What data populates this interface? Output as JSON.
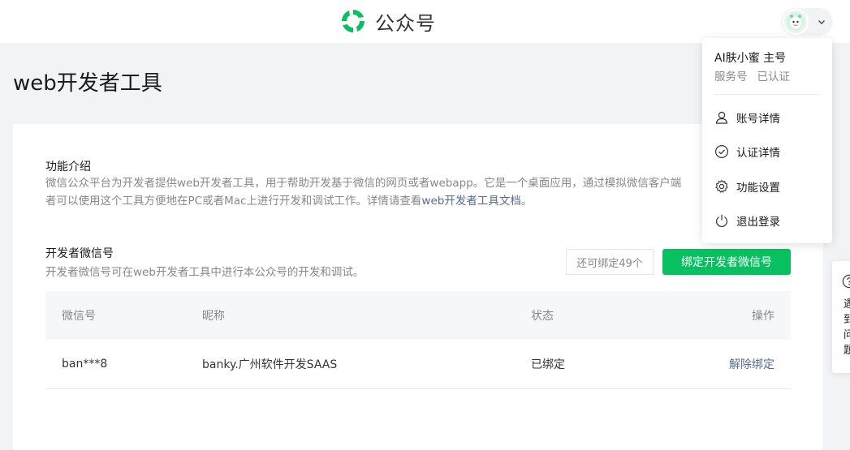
{
  "header": {
    "brand": "公众号",
    "brand_color": "#07c160",
    "account_menu_icon": "chevron-down-icon"
  },
  "page": {
    "title": "web开发者工具"
  },
  "intro": {
    "title": "功能介绍",
    "desc_line1": "微信公众平台为开发者提供web开发者工具，用于帮助开发基于微信的网页或者webapp。它是一个桌面应用，通过模拟微信客户端",
    "desc_line2_a": "者可以使用这个工具方便地在PC或者Mac上进行开发和调试工作。详情请查看",
    "desc_link": "web开发者工具文档",
    "desc_line2_b": "。"
  },
  "developer": {
    "title": "开发者微信号",
    "desc": "开发者微信号可在web开发者工具中进行本公众号的开发和调试。",
    "remaining": "还可绑定49个",
    "bind_button": "绑定开发者微信号"
  },
  "table": {
    "columns": [
      "微信号",
      "昵称",
      "状态",
      "操作"
    ],
    "rows": [
      {
        "wechat_id": "ban***8",
        "nickname": "banky.广州软件开发SAAS",
        "status": "已绑定",
        "action": "解除绑定"
      }
    ]
  },
  "account_menu": {
    "name": "AI肤小蜜 主号",
    "type": "服务号",
    "verified": "已认证",
    "items": [
      {
        "label": "账号详情",
        "icon": "user-icon"
      },
      {
        "label": "认证详情",
        "icon": "check-circle-icon"
      },
      {
        "label": "功能设置",
        "icon": "gear-icon"
      },
      {
        "label": "退出登录",
        "icon": "power-icon"
      }
    ]
  },
  "help_widget": {
    "icon": "question-icon",
    "text": "遇到问题"
  }
}
